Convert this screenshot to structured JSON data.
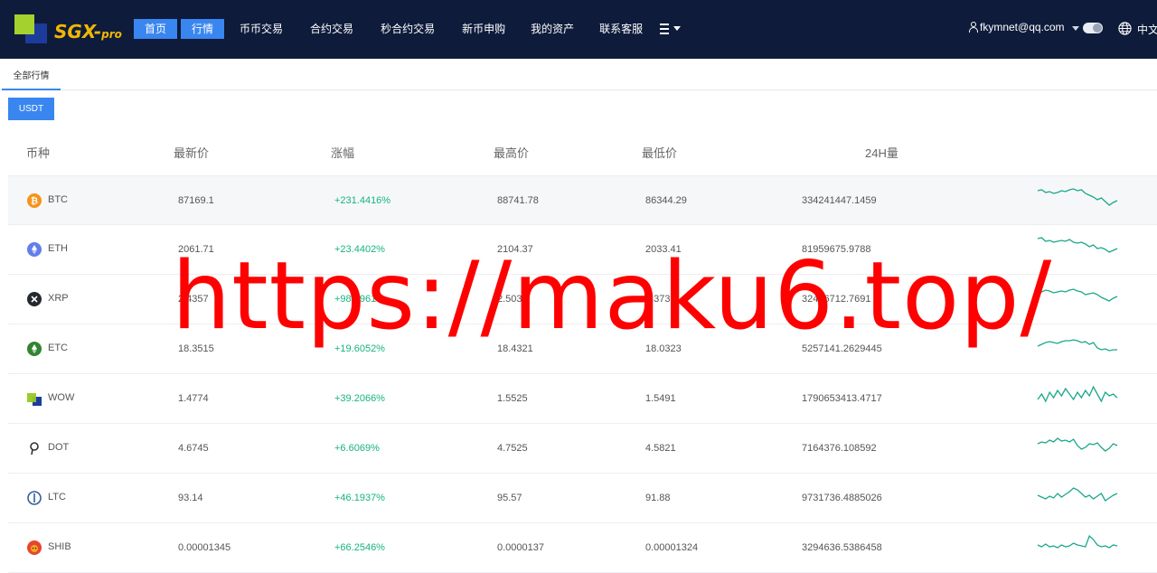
{
  "header": {
    "logo_text": "SGX-pro",
    "nav": [
      {
        "label": "首页",
        "active": true
      },
      {
        "label": "行情",
        "active": true
      },
      {
        "label": "币币交易",
        "active": false
      },
      {
        "label": "合约交易",
        "active": false
      },
      {
        "label": "秒合约交易",
        "active": false
      },
      {
        "label": "新币申购",
        "active": false
      },
      {
        "label": "我的资产",
        "active": false
      },
      {
        "label": "联系客服",
        "active": false
      }
    ],
    "menu_icon": "list-icon",
    "user_email": "fkymnet@qq.com",
    "language": "中文"
  },
  "tabs": {
    "all_markets": "全部行情"
  },
  "filter": {
    "usdt_label": "USDT"
  },
  "table": {
    "headers": {
      "coin": "币种",
      "latest_price": "最新价",
      "change": "涨幅",
      "high": "最高价",
      "low": "最低价",
      "volume": "24H量"
    },
    "rows": [
      {
        "coin": "BTC",
        "price": "87169.1",
        "change": "+231.4416%",
        "high": "88741.78",
        "low": "86344.29",
        "volume": "334241447.1459",
        "icon": "btc-icon",
        "color": "#f7931a",
        "spark": [
          6,
          5,
          8,
          7,
          9,
          8,
          6,
          7,
          5,
          4,
          6,
          5,
          9,
          11,
          13,
          16,
          14,
          18,
          22,
          19,
          17
        ]
      },
      {
        "coin": "ETH",
        "price": "2061.71",
        "change": "+23.4402%",
        "high": "2104.37",
        "low": "2033.41",
        "volume": "81959675.9788",
        "icon": "eth-icon",
        "color": "#627eea",
        "spark": [
          5,
          4,
          8,
          7,
          9,
          8,
          7,
          8,
          6,
          9,
          10,
          9,
          11,
          14,
          12,
          16,
          15,
          17,
          20,
          18,
          16
        ]
      },
      {
        "coin": "XRP",
        "price": "2.4357",
        "change": "+98.9961%",
        "high": "2.5037",
        "low": "2.3732",
        "volume": "32456712.7691",
        "icon": "xrp-icon",
        "color": "#23292f",
        "spark": [
          8,
          9,
          7,
          8,
          10,
          9,
          8,
          9,
          7,
          6,
          8,
          9,
          12,
          11,
          10,
          12,
          15,
          17,
          19,
          16,
          14
        ]
      },
      {
        "coin": "ETC",
        "price": "18.3515",
        "change": "+19.6052%",
        "high": "18.4321",
        "low": "18.0323",
        "volume": "5257141.2629445",
        "icon": "etc-icon",
        "color": "#328432",
        "spark": [
          14,
          12,
          10,
          9,
          10,
          11,
          9,
          8,
          8,
          7,
          8,
          10,
          9,
          12,
          10,
          16,
          18,
          17,
          19,
          18,
          18
        ]
      },
      {
        "coin": "WOW",
        "price": "1.4774",
        "change": "+39.2066%",
        "high": "1.5525",
        "low": "1.5491",
        "volume": "1790653413.4717",
        "icon": "wow-icon",
        "color": "#9ccc2c",
        "spark": [
          18,
          12,
          20,
          10,
          16,
          8,
          14,
          6,
          12,
          18,
          10,
          16,
          8,
          14,
          4,
          12,
          20,
          10,
          14,
          12,
          16
        ]
      },
      {
        "coin": "DOT",
        "price": "4.6745",
        "change": "+6.6069%",
        "high": "4.7525",
        "low": "4.5821",
        "volume": "7164376.108592",
        "icon": "dot-icon",
        "color": "#333333",
        "spark": [
          12,
          10,
          11,
          8,
          10,
          6,
          9,
          8,
          10,
          7,
          14,
          18,
          16,
          12,
          13,
          11,
          16,
          20,
          17,
          12,
          14
        ]
      },
      {
        "coin": "LTC",
        "price": "93.14",
        "change": "+46.1937%",
        "high": "95.57",
        "low": "91.88",
        "volume": "9731736.4885026",
        "icon": "ltc-icon",
        "color": "#345d9d",
        "spark": [
          14,
          16,
          18,
          15,
          17,
          12,
          16,
          13,
          10,
          6,
          8,
          12,
          16,
          14,
          18,
          15,
          12,
          20,
          17,
          14,
          12
        ]
      },
      {
        "coin": "SHIB",
        "price": "0.00001345",
        "change": "+66.2546%",
        "high": "0.0000137",
        "low": "0.00001324",
        "volume": "3294636.5386458",
        "icon": "shib-icon",
        "color": "#e8462c",
        "spark": [
          14,
          16,
          13,
          16,
          15,
          17,
          14,
          16,
          15,
          12,
          14,
          15,
          16,
          4,
          8,
          14,
          16,
          15,
          17,
          14,
          15
        ]
      }
    ]
  },
  "watermark": "https://maku6.top/",
  "colors": {
    "header_bg": "#0e1b3a",
    "accent": "#3a86f0",
    "up": "#17b47f",
    "spark_line": "#1aa88a",
    "watermark": "#ff0000"
  }
}
